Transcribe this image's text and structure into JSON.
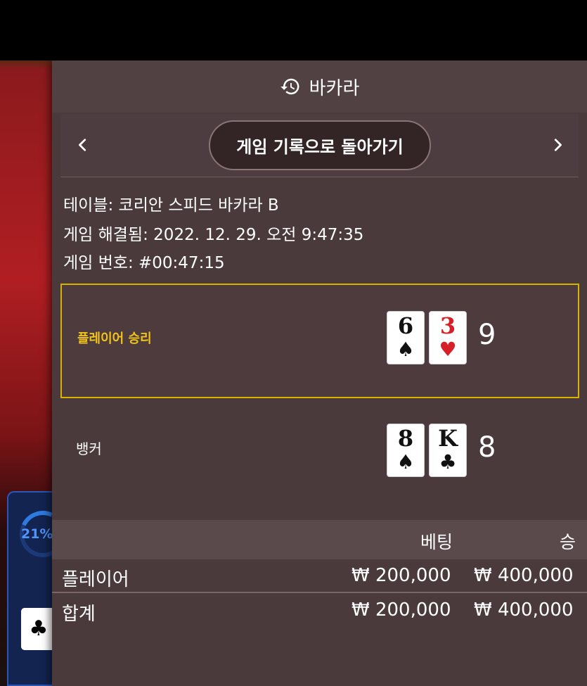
{
  "header": {
    "title": "바카라",
    "icon": "history-icon"
  },
  "nav": {
    "back_label": "게임 기록으로 돌아가기",
    "prev_icon": "chevron-left-icon",
    "next_icon": "chevron-right-icon"
  },
  "info": {
    "table": "테이블: 코리안 스피드 바카라 B",
    "resolved": "게임 해결됨: 2022. 12. 29. 오전 9:47:35",
    "game_number": "게임 번호: #00:47:15"
  },
  "player": {
    "label": "플레이어 승리",
    "cards": [
      {
        "rank": "6",
        "suit": "♠",
        "color": "#111111"
      },
      {
        "rank": "3",
        "suit": "♥",
        "color": "#d61f26"
      }
    ],
    "total": "9"
  },
  "banker": {
    "label": "뱅커",
    "cards": [
      {
        "rank": "8",
        "suit": "♠",
        "color": "#111111"
      },
      {
        "rank": "K",
        "suit": "♣",
        "color": "#111111"
      }
    ],
    "total": "8"
  },
  "bets_table": {
    "headers": {
      "bet": "베팅",
      "win": "승"
    },
    "rows": [
      {
        "name": "플레이어",
        "bet": "₩ 200,000",
        "win": "₩ 400,000"
      },
      {
        "name": "합계",
        "bet": "₩ 200,000",
        "win": "₩ 400,000"
      }
    ]
  },
  "background": {
    "progress": "21%",
    "accent": "#d9b200"
  }
}
